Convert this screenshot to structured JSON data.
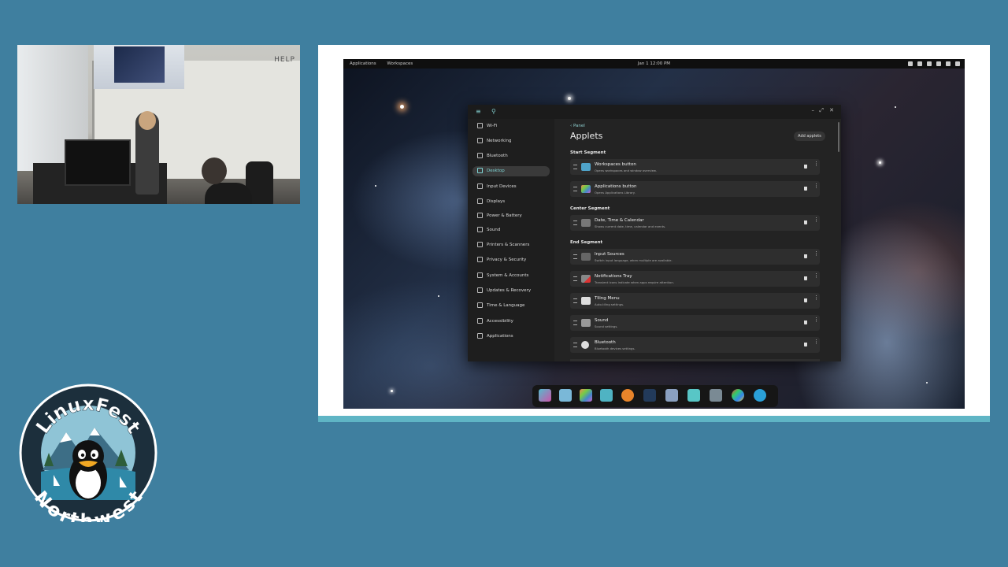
{
  "desktop": {
    "topbar": {
      "applications": "Applications",
      "workspaces": "Workspaces",
      "clock": "Jan 1 12:00 PM"
    }
  },
  "settings": {
    "sidebar": [
      {
        "label": "Wi-Fi",
        "icon": "wifi-icon"
      },
      {
        "label": "Networking",
        "icon": "network-icon"
      },
      {
        "label": "Bluetooth",
        "icon": "bluetooth-icon"
      },
      {
        "label": "Desktop",
        "icon": "desktop-icon",
        "active": true
      },
      {
        "label": "Input Devices",
        "icon": "keyboard-icon"
      },
      {
        "label": "Displays",
        "icon": "display-icon"
      },
      {
        "label": "Power & Battery",
        "icon": "battery-icon"
      },
      {
        "label": "Sound",
        "icon": "sound-icon"
      },
      {
        "label": "Printers & Scanners",
        "icon": "printer-icon"
      },
      {
        "label": "Privacy & Security",
        "icon": "shield-icon"
      },
      {
        "label": "System & Accounts",
        "icon": "system-icon"
      },
      {
        "label": "Updates & Recovery",
        "icon": "update-icon"
      },
      {
        "label": "Time & Language",
        "icon": "clock-icon"
      },
      {
        "label": "Accessibility",
        "icon": "accessibility-icon"
      },
      {
        "label": "Applications",
        "icon": "apps-icon"
      }
    ],
    "breadcrumb": "Panel",
    "title": "Applets",
    "add_button": "Add applets",
    "segments": {
      "start": "Start Segment",
      "center": "Center Segment",
      "end": "End Segment"
    },
    "start_rows": [
      {
        "title": "Workspaces button",
        "desc": "Opens workspaces and window overview."
      },
      {
        "title": "Applications button",
        "desc": "Opens Applications Library."
      }
    ],
    "center_rows": [
      {
        "title": "Date, Time & Calendar",
        "desc": "Shows current date, time, calendar and events."
      }
    ],
    "end_rows": [
      {
        "title": "Input Sources",
        "desc": "Switch input language, when multiple are available."
      },
      {
        "title": "Notifications Tray",
        "desc": "Transient icons indicate when apps require attention."
      },
      {
        "title": "Tiling Menu",
        "desc": "Auto-tiling settings."
      },
      {
        "title": "Sound",
        "desc": "Sound settings."
      },
      {
        "title": "Bluetooth",
        "desc": "Bluetooth devices settings."
      }
    ]
  },
  "room": {
    "sign": "HELP"
  },
  "logo": {
    "top": "LinuxFest",
    "bottom": "Northwest"
  },
  "colors": {
    "background": "#3f7f9f",
    "accent": "#7fd6d6",
    "band": "#5fb5c5"
  }
}
